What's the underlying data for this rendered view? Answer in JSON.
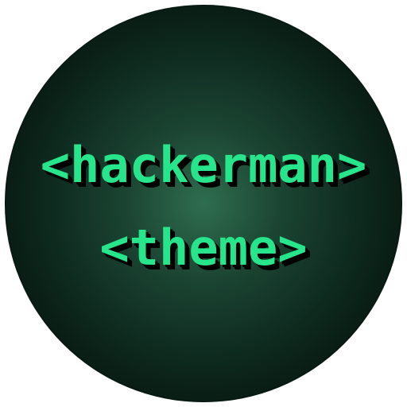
{
  "logo": {
    "line1": "<hackerman>",
    "line2": "<theme>",
    "text_color": "#27e58a",
    "shadow_color": "#000000",
    "background_center_color": "#2f6e4f",
    "background_edge_color": "#020806"
  }
}
